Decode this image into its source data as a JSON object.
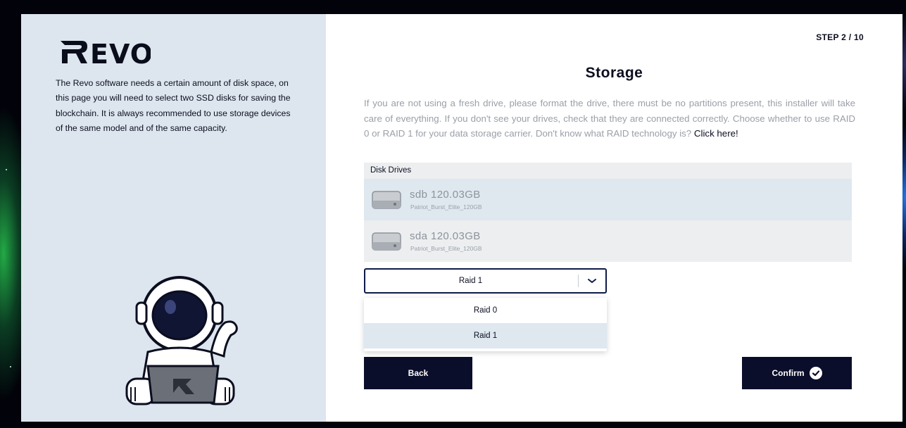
{
  "step": "STEP 2 / 10",
  "brand": {
    "logo": "REVO",
    "intro": "The Revo software needs a certain amount of disk space, on this page you will need to select two SSD disks for saving the blockchain. It is always recommended to use storage devices of the same model and of the same capacity."
  },
  "main": {
    "title": "Storage",
    "description": "If you are not using a fresh drive, please format the drive, there must be no partitions present, this installer will take care of everything. If you don't see your drives, check that they are connected correctly. Choose whether to use RAID 0 or RAID 1 for your data storage carrier. Don't know what RAID technology is?",
    "link_text": "Click here!"
  },
  "drives": {
    "header": "Disk Drives",
    "items": [
      {
        "name": "sdb  120.03GB",
        "model": "Patriot_Burst_Elite_120GB",
        "selected": true
      },
      {
        "name": "sda  120.03GB",
        "model": "Patriot_Burst_Elite_120GB",
        "selected": false
      }
    ]
  },
  "raid_select": {
    "value": "Raid 1",
    "options": [
      "Raid 0",
      "Raid 1"
    ]
  },
  "buttons": {
    "back": "Back",
    "confirm": "Confirm"
  },
  "colors": {
    "panel": "#dde6ee",
    "button": "#0b0e2a",
    "select_border": "#0e1a4a",
    "highlight": "#dfe7ef"
  }
}
